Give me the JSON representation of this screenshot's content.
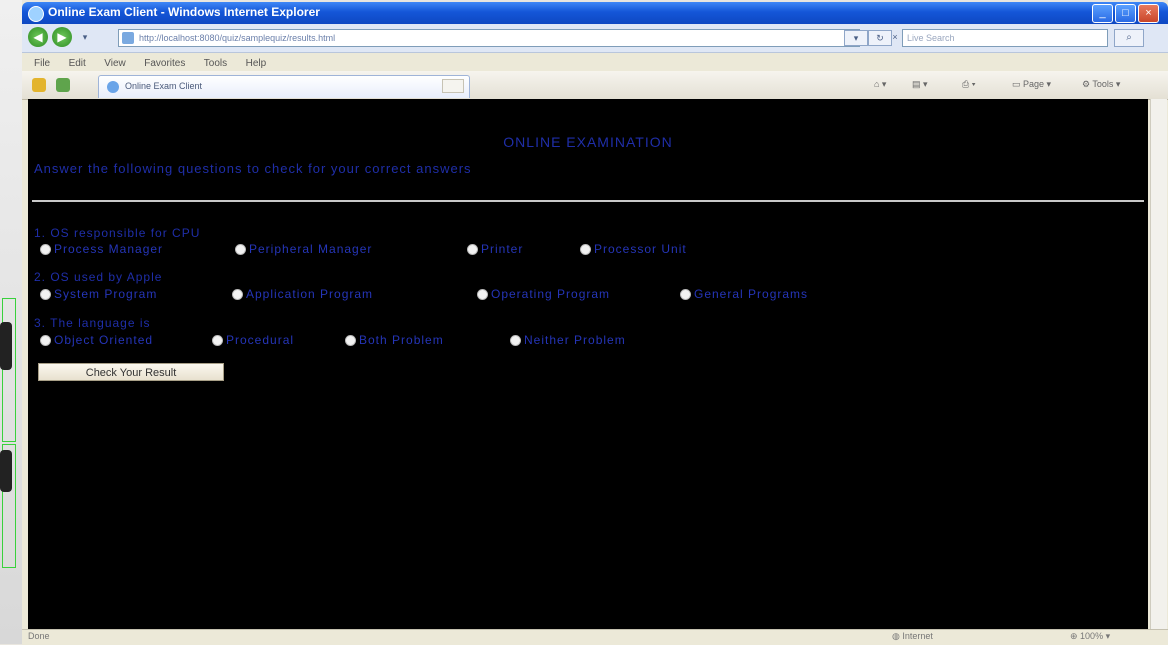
{
  "window": {
    "title": "Online Exam Client - Windows Internet Explorer",
    "address": "http://localhost:8080/quiz/samplequiz/results.html",
    "search_placeholder": "Live Search"
  },
  "menu": [
    "File",
    "Edit",
    "View",
    "Favorites",
    "Tools",
    "Help"
  ],
  "tab": {
    "label": "Online Exam Client"
  },
  "toolbar": {
    "page_label": "Page",
    "tools_label": "Tools"
  },
  "page": {
    "title": "ONLINE EXAMINATION",
    "instruction": "Answer the following questions to check for your correct answers"
  },
  "questions": [
    {
      "prompt": "1. OS responsible for CPU",
      "options": [
        "Process Manager",
        "Peripheral Manager",
        "Printer",
        "Processor Unit"
      ]
    },
    {
      "prompt": "2. OS used by Apple",
      "options": [
        "System Program",
        "Application Program",
        "Operating Program",
        "General Programs"
      ]
    },
    {
      "prompt": "3. The language is",
      "options": [
        "Object Oriented",
        "Procedural",
        "Both Problem",
        "Neither Problem"
      ]
    }
  ],
  "submit_label": "Check Your Result",
  "statusbar": {
    "status": "Done",
    "zone": "Internet",
    "zoom": "100%"
  },
  "colors": {
    "page_bg": "#000000",
    "text": "#1f2ea8",
    "title_bar": "#1456d8"
  }
}
